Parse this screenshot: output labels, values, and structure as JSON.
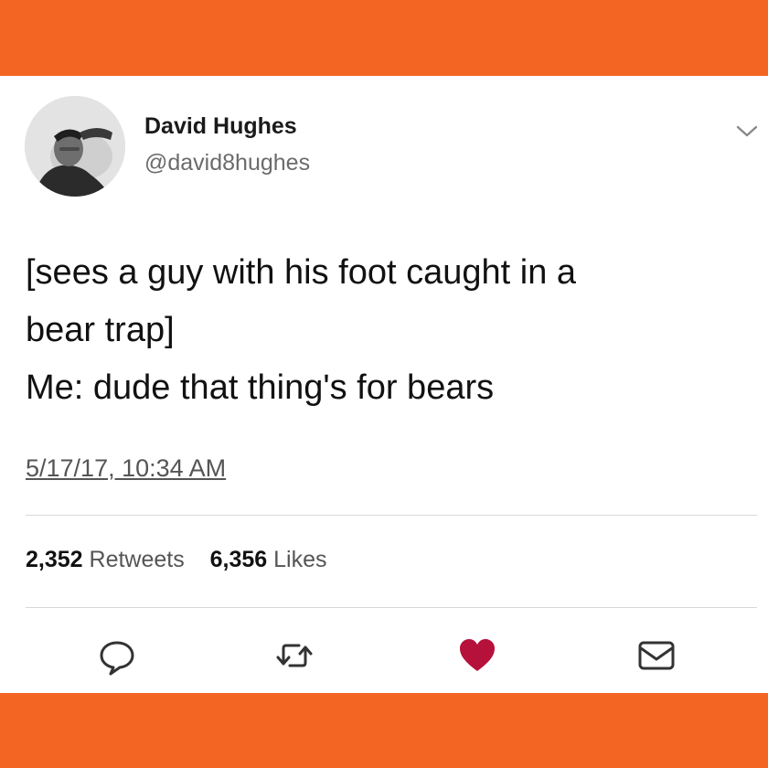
{
  "colors": {
    "band": "#f26522",
    "background": "#ffffff",
    "like_heart": "#b5113a"
  },
  "author": {
    "name": "David Hughes",
    "handle": "@david8hughes",
    "avatar_icon": "user-avatar"
  },
  "tweet": {
    "text_lines": [
      "[sees a guy with his foot caught in a",
      "bear trap]",
      "Me: dude that thing's for bears"
    ],
    "timestamp": "5/17/17, 10:34 AM"
  },
  "stats": {
    "retweets_count": "2,352",
    "retweets_label": "Retweets",
    "likes_count": "6,356",
    "likes_label": "Likes"
  },
  "actions": {
    "reply_icon": "reply-icon",
    "retweet_icon": "retweet-icon",
    "like_icon": "heart-icon",
    "dm_icon": "envelope-icon",
    "menu_icon": "chevron-down-icon"
  }
}
